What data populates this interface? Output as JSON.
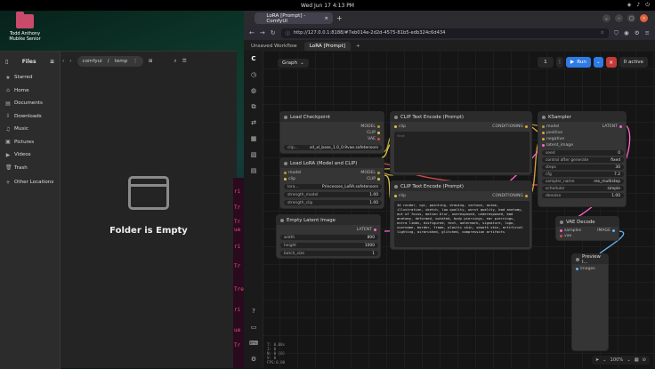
{
  "topbar": {
    "datetime": "Wed Jun 17  4:13 PM"
  },
  "desktop": {
    "icon_label": "Todd Anthony Mubike Senior"
  },
  "files": {
    "title": "Files",
    "sidebar": [
      "Starred",
      "Home",
      "Documents",
      "Downloads",
      "Music",
      "Pictures",
      "Videos",
      "Trash",
      "Other Locations"
    ],
    "path": [
      "comfyui",
      "temp"
    ],
    "empty_message": "Folder is Empty"
  },
  "terminal_fragments": [
    "ri",
    "Tr",
    "Tr",
    "ri",
    "ue",
    "ri",
    "Tr",
    "Tr",
    "ri",
    "Tre",
    "ri",
    "ue",
    "ri",
    "Tr"
  ],
  "browser": {
    "tab_title": "LoRA [Prompt] - ComfyUI",
    "url": "http://127.0.0.1:8188/#7eb014e-2d2d-4575-81b5-edb324c6d434",
    "zoom": "100%"
  },
  "comfy": {
    "workflow_tabs": [
      "Unsaved Workflow",
      "LoRA [Prompt]"
    ],
    "graph_label": "Graph",
    "queue_count": "1",
    "run_label": "Run",
    "active_label": "0 active",
    "zoom_label": "100%",
    "stats": [
      "T: 0.00s",
      "I: 0",
      "N: 0 [0]",
      "V: 0",
      "FPS:0.00"
    ],
    "nodes": {
      "load_checkpoint": {
        "title": "Load Checkpoint",
        "outputs": [
          "MODEL",
          "CLIP",
          "VAE"
        ],
        "widget_label": "clip...",
        "widget_value": "sd_xl_base_1.0_0.9vae.safetensors"
      },
      "load_lora": {
        "title": "Load LoRA (Model and CLIP)",
        "inputs": [
          "model",
          "clip"
        ],
        "outputs": [
          "MODEL",
          "CLIP"
        ],
        "widgets": [
          {
            "label": "lora...",
            "value": "Princesses_LoRA.safetensors"
          },
          {
            "label": "strength_model",
            "value": "1.00"
          },
          {
            "label": "strength_clip",
            "value": "1.00"
          }
        ]
      },
      "empty_latent": {
        "title": "Empty Latent Image",
        "output": "LATENT",
        "widgets": [
          {
            "label": "width",
            "value": "800"
          },
          {
            "label": "height",
            "value": "1000"
          },
          {
            "label": "batch_size",
            "value": "1"
          }
        ]
      },
      "clip_pos": {
        "title": "CLIP Text Encode (Prompt)",
        "input": "clip",
        "output": "CONDITIONING",
        "text": "text"
      },
      "clip_neg": {
        "title": "CLIP Text Encode (Prompt)",
        "input": "clip",
        "output": "CONDITIONING",
        "text": "3d render, cgi, painting, drawing, cartoon, anime, illustration, sketch, low quality, worst quality, bad anatomy, out of focus, motion blur, overexposed, underexposed, bad anatomy, deformed, mutated, body piercings, ear piercings, extra limbs, disfigured, text, watermark, signature, logo, username, border, frame, plastic skin, smooth skin, artificial lighting, airbrushed, glitched, compression artifacts"
      },
      "ksampler": {
        "title": "KSampler",
        "inputs": [
          "model",
          "positive",
          "negative",
          "latent_image"
        ],
        "output": "LATENT",
        "widgets": [
          {
            "label": "seed",
            "value": "0"
          },
          {
            "label": "control after generate",
            "value": "fixed"
          },
          {
            "label": "steps",
            "value": "30"
          },
          {
            "label": "cfg",
            "value": "7.2"
          },
          {
            "label": "sampler_name",
            "value": "res_multistep"
          },
          {
            "label": "scheduler",
            "value": "simple"
          },
          {
            "label": "denoise",
            "value": "1.00"
          }
        ]
      },
      "vae_decode": {
        "title": "VAE Decode",
        "inputs": [
          "samples",
          "vae"
        ],
        "output": "IMAGE"
      },
      "preview": {
        "title": "Preview I...",
        "input": "images"
      }
    }
  }
}
